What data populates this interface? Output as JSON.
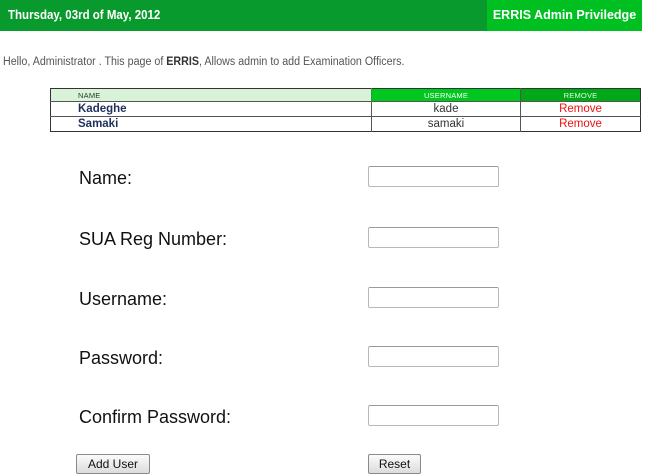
{
  "header": {
    "date": "Thursday, 03rd of May, 2012",
    "privilege": "ERRIS Admin Priviledge"
  },
  "greeting": {
    "prefix": "Hello, Administrator . This page of ",
    "app_name": "ERRIS",
    "suffix": ", Allows admin to add Examination Officers."
  },
  "officers_table": {
    "columns": [
      "NAME",
      "USERNAME",
      "REMOVE"
    ],
    "rows": [
      {
        "name": "Kadeghe",
        "username": "kade",
        "action": "Remove"
      },
      {
        "name": "Samaki",
        "username": "samaki",
        "action": "Remove"
      }
    ]
  },
  "form": {
    "name_label": "Name:",
    "name_value": "",
    "reg_label": "SUA Reg Number:",
    "reg_value": "",
    "username_label": "Username:",
    "username_value": "",
    "password_label": "Password:",
    "password_value": "",
    "confirm_label": "Confirm Password:",
    "confirm_value": "",
    "add_button": "Add User",
    "reset_button": "Reset"
  },
  "colors": {
    "header_green": "#089a2c",
    "privilege_green": "#00c021",
    "remove_red": "#ee1111",
    "name_blue": "#1d2f5c"
  }
}
